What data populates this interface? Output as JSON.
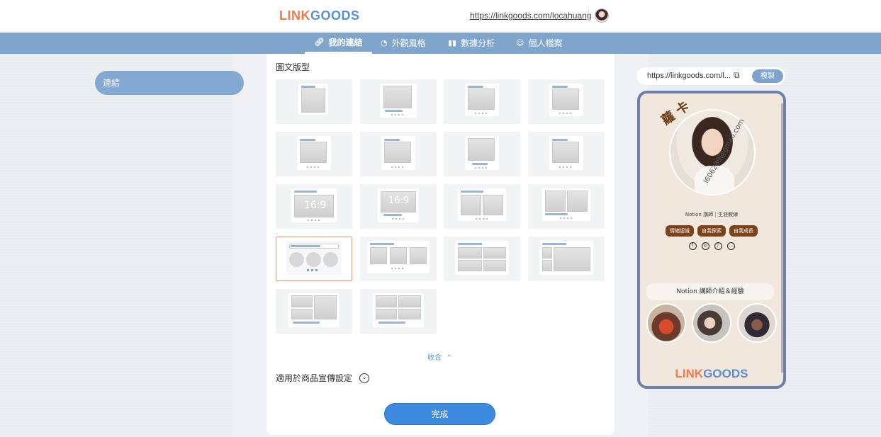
{
  "header": {
    "logo_part1": "LINK",
    "logo_part2": "GOODS",
    "profile_url": "https://linkgoods.com/locahuang"
  },
  "nav": {
    "tabs": [
      {
        "label": "我的連結",
        "icon": "link-icon",
        "active": true
      },
      {
        "label": "外觀風格",
        "icon": "palette-icon",
        "active": false
      },
      {
        "label": "數據分析",
        "icon": "bar-chart-icon",
        "active": false
      },
      {
        "label": "個人檔案",
        "icon": "user-icon",
        "active": false
      }
    ]
  },
  "sidebar": {
    "active_item": "連結"
  },
  "main": {
    "section_title": "圖文版型",
    "ratio_label": "16:9",
    "collapse_label": "收合",
    "promo_label": "適用於商品宣傳設定",
    "done_button": "完成",
    "selected_layout_index": 12
  },
  "preview": {
    "url": "https://linkgoods.com/l...",
    "copy_button": "複製",
    "profile_name": "蘿 卡",
    "email": "l606289@gmail.com",
    "title_line": "Notion 講師｜生涯教練",
    "tags": [
      "情緒認識",
      "自我探索",
      "自我成長"
    ],
    "social_icons": [
      "facebook-icon",
      "instagram-icon",
      "podcast-icon",
      "line-icon"
    ],
    "link_button": "Notion 講師介紹＆經驗",
    "footer_logo_part1": "LINK",
    "footer_logo_part2": "GOODS"
  },
  "colors": {
    "nav_bg": "#7fa5cd",
    "accent_blue": "#3d8ae0",
    "selected_border": "#ee8e66",
    "tag_brown": "#7a431a",
    "phone_bg": "#f1e7dd"
  }
}
